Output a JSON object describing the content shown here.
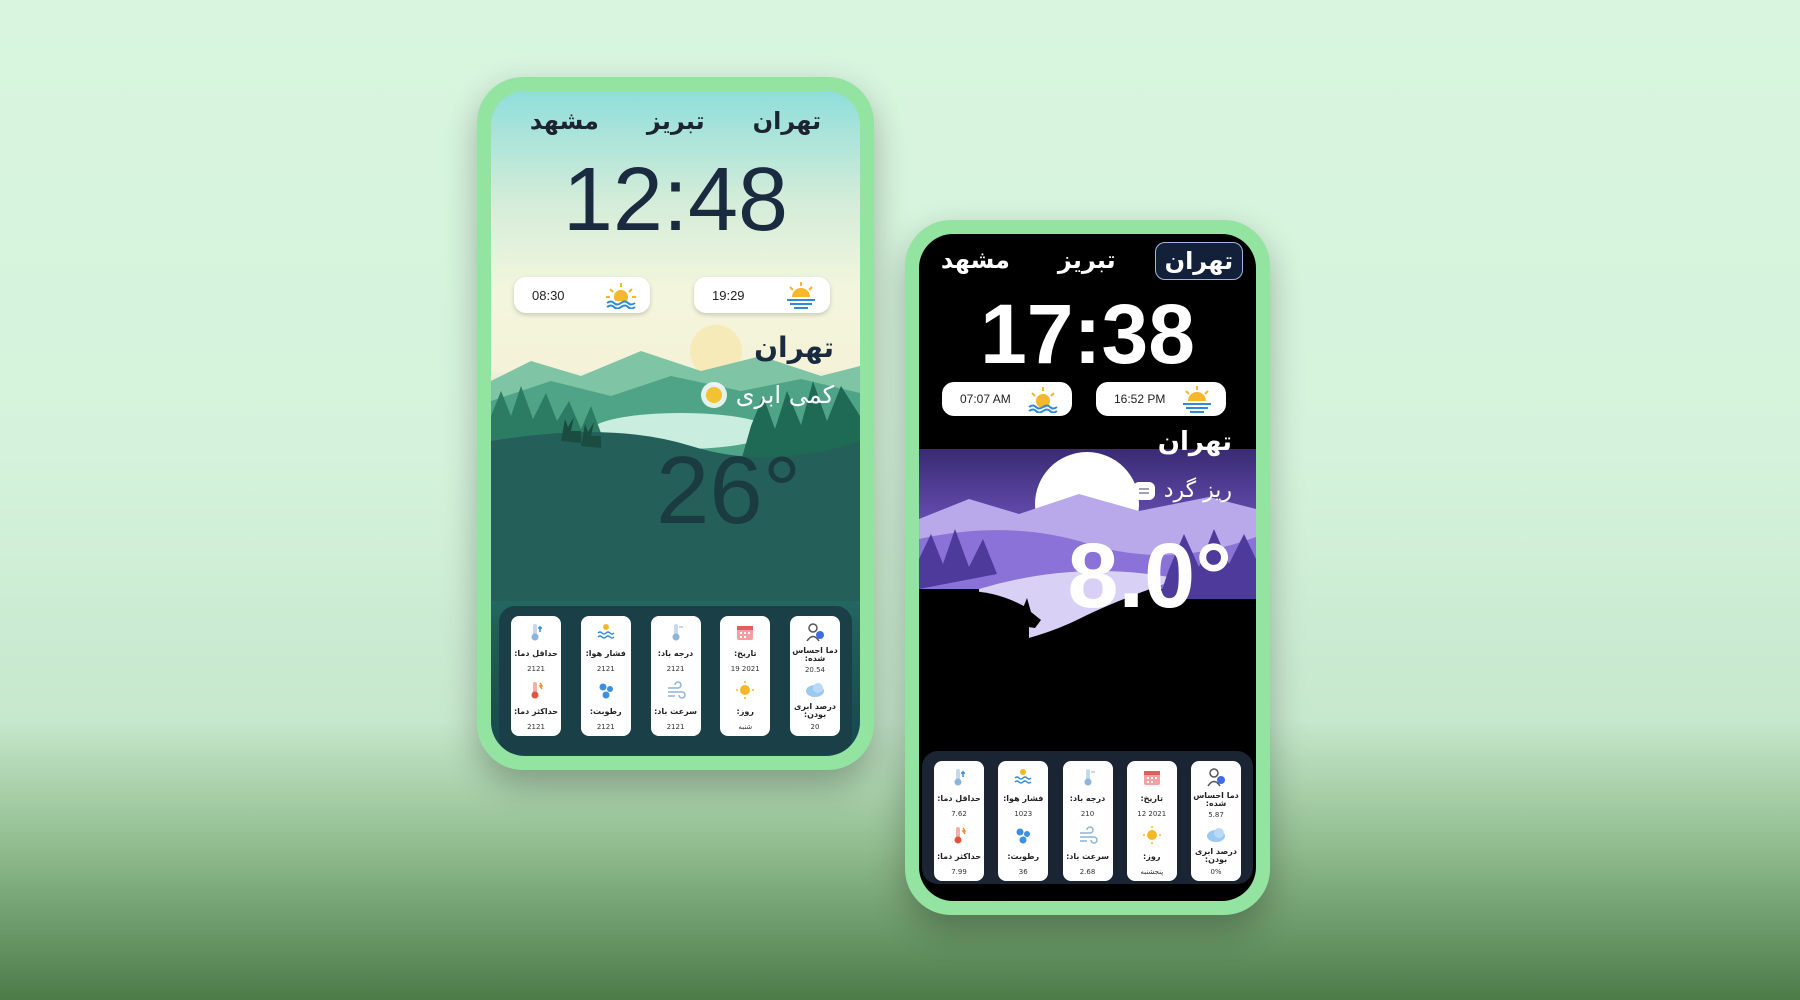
{
  "phones": [
    {
      "tabs": [
        "تهران",
        "تبریز",
        "مشهد"
      ],
      "active_tab": "",
      "time": "12:48",
      "sunrise": "08:30",
      "sunset": "19:29",
      "city": "تهران",
      "condition": "کمی ابری",
      "temperature": "26°",
      "cards": [
        {
          "top_label": "دما احساس شده:",
          "top_value": "20.54",
          "bottom_label": "درصد ابری بودن:",
          "bottom_value": "20",
          "top_icon": "person-thermometer-icon",
          "bottom_icon": "cloud-icon"
        },
        {
          "top_label": "تاریخ:",
          "top_value": "19 2021",
          "bottom_label": "روز:",
          "bottom_value": "شنبه",
          "top_icon": "calendar-icon",
          "bottom_icon": "sun-icon"
        },
        {
          "top_label": "درجه باد:",
          "top_value": "2121",
          "bottom_label": "سرعت باد:",
          "bottom_value": "2121",
          "top_icon": "thermometer-icon",
          "bottom_icon": "wind-icon"
        },
        {
          "top_label": "فشار هوا:",
          "top_value": "2121",
          "bottom_label": "رطوبت:",
          "bottom_value": "2121",
          "top_icon": "pressure-icon",
          "bottom_icon": "humidity-icon"
        },
        {
          "top_label": "حداقل دما:",
          "top_value": "2121",
          "bottom_label": "حداکثر دما:",
          "bottom_value": "2121",
          "top_icon": "thermometer-cold-icon",
          "bottom_icon": "thermometer-hot-icon"
        }
      ]
    },
    {
      "tabs": [
        "تهران",
        "تبریز",
        "مشهد"
      ],
      "active_tab": "تهران",
      "time": "17:38",
      "sunrise": "07:07 AM",
      "sunset": "16:52 PM",
      "city": "تهران",
      "condition": "ریز گرد",
      "temperature": "8.0°",
      "cards": [
        {
          "top_label": "دما احساس شده:",
          "top_value": "5.87",
          "bottom_label": "درصد ابری بودن:",
          "bottom_value": "0%",
          "top_icon": "person-thermometer-icon",
          "bottom_icon": "cloud-icon"
        },
        {
          "top_label": "تاریخ:",
          "top_value": "12 2021",
          "bottom_label": "روز:",
          "bottom_value": "پنجشنبه",
          "top_icon": "calendar-icon",
          "bottom_icon": "sun-icon"
        },
        {
          "top_label": "درجه باد:",
          "top_value": "210",
          "bottom_label": "سرعت باد:",
          "bottom_value": "2.68",
          "top_icon": "thermometer-icon",
          "bottom_icon": "wind-icon"
        },
        {
          "top_label": "فشار هوا:",
          "top_value": "1023",
          "bottom_label": "رطوبت:",
          "bottom_value": "36",
          "top_icon": "pressure-icon",
          "bottom_icon": "humidity-icon"
        },
        {
          "top_label": "حداقل دما:",
          "top_value": "7.62",
          "bottom_label": "حداکثر دما:",
          "bottom_value": "7.99",
          "top_icon": "thermometer-cold-icon",
          "bottom_icon": "thermometer-hot-icon"
        }
      ]
    }
  ],
  "colors": {
    "frame": "#93e3a1",
    "accent_dark": "#12203a",
    "night_purple": "#6d4fc4",
    "day_teal": "#2a7b69"
  }
}
